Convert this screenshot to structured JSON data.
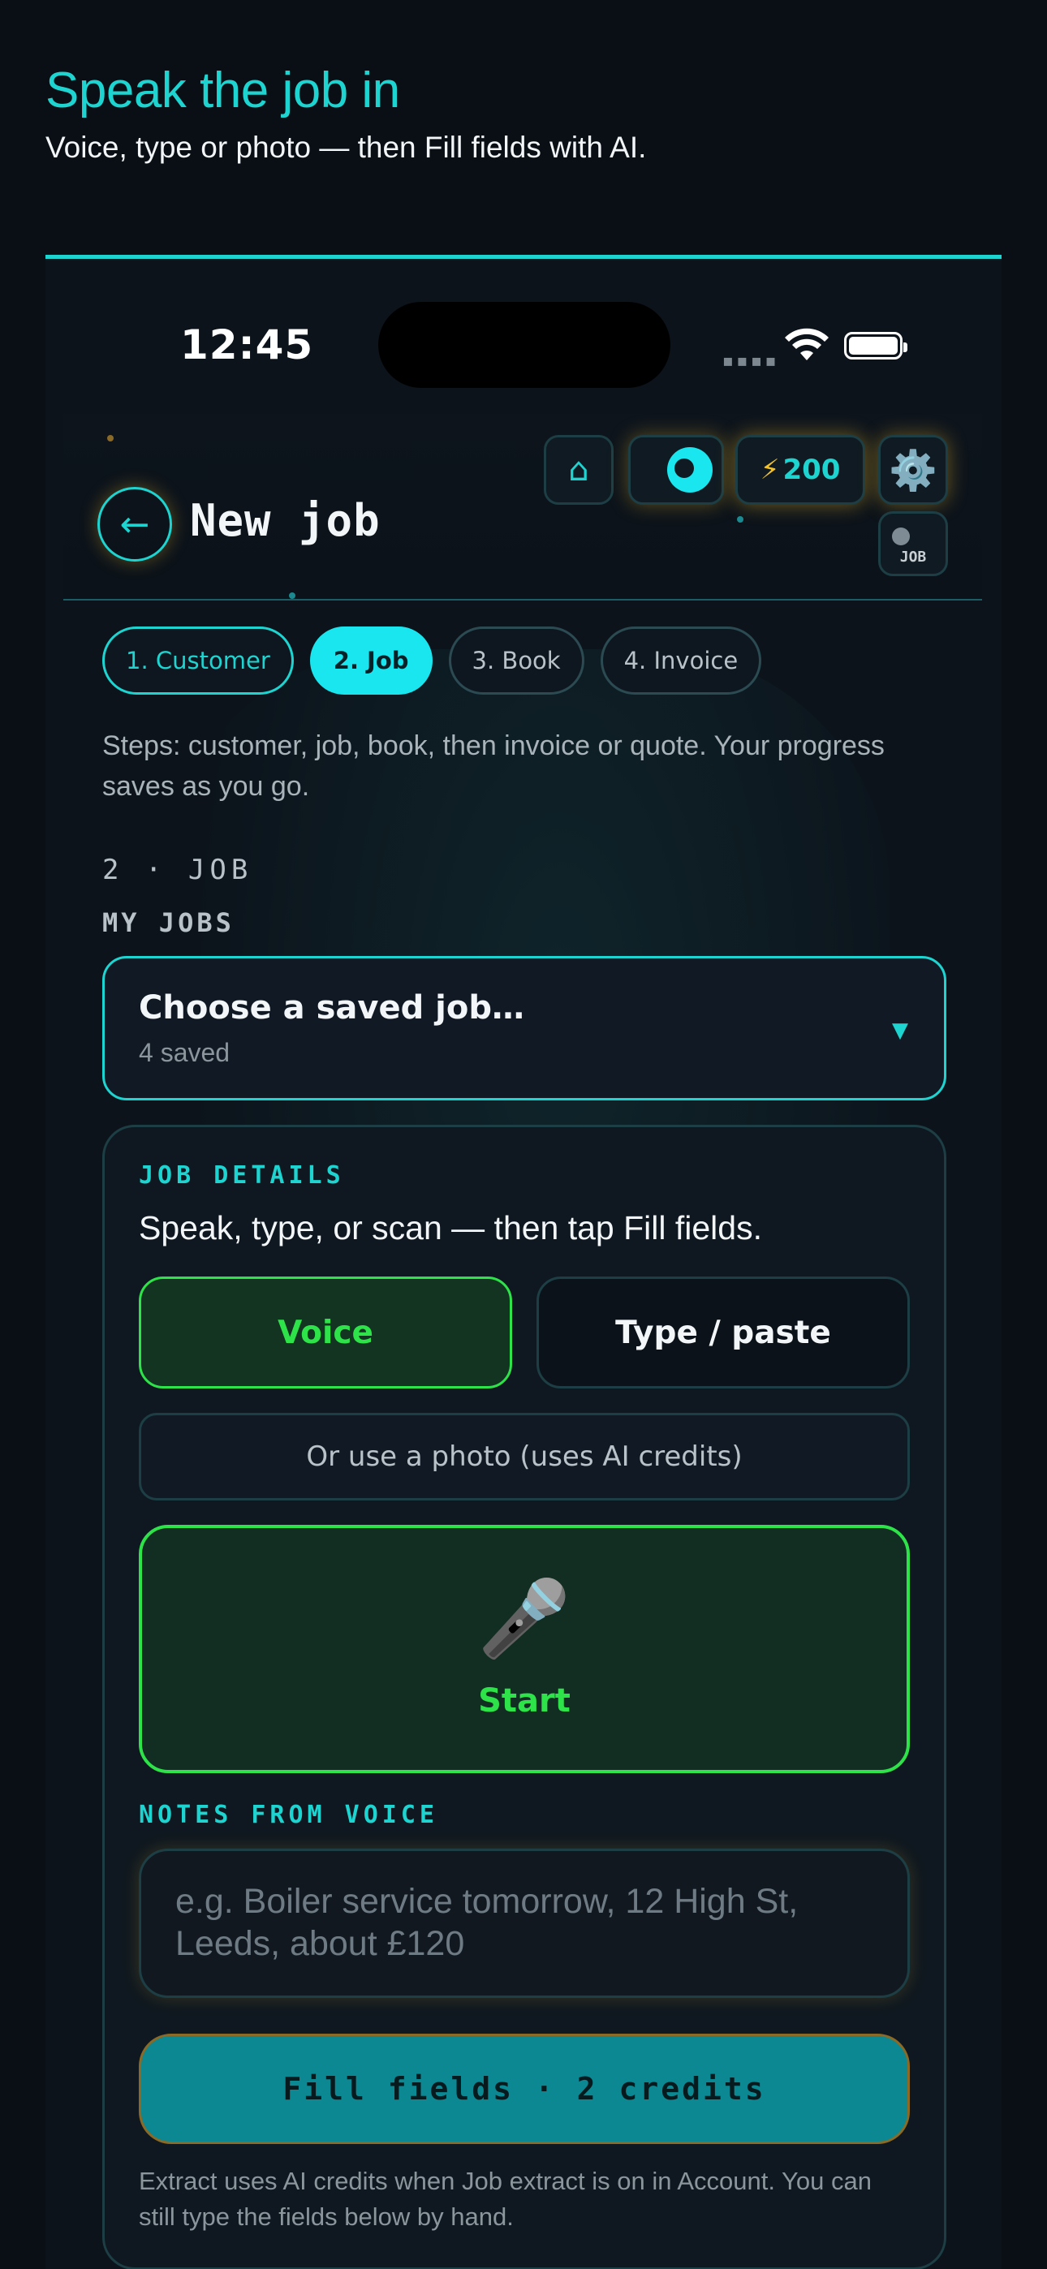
{
  "hero": {
    "title": "Speak the job in",
    "subtitle": "Voice, type or photo — then Fill fields with AI."
  },
  "status": {
    "time": "12:45"
  },
  "header": {
    "title": "New job",
    "home_icon": "⌂",
    "credits": "200",
    "gear_icon": "⚙️",
    "job_toggle_label": "JOB"
  },
  "steps": [
    {
      "label": "1. Customer"
    },
    {
      "label": "2. Job"
    },
    {
      "label": "3. Book"
    },
    {
      "label": "4. Invoice"
    }
  ],
  "steps_text": "Steps: customer, job, book, then invoice or quote. Your progress saves as you go.",
  "section": {
    "eyebrow": "2 · JOB",
    "my_jobs_label": "MY JOBS"
  },
  "saved_jobs": {
    "selected": "Choose a saved job…",
    "count": "4 saved"
  },
  "job_details": {
    "eyebrow": "JOB DETAILS",
    "subtitle": "Speak, type, or scan — then tap Fill fields.",
    "voice_label": "Voice",
    "type_label": "Type / paste",
    "photo_label": "Or use a photo (uses AI credits)",
    "mic_icon": "🎤",
    "start_label": "Start",
    "notes_label": "NOTES FROM VOICE",
    "notes_placeholder": "e.g. Boiler service tomorrow, 12 High St, Leeds, about £120",
    "fill_label": "Fill fields · 2 credits",
    "footnote": "Extract uses AI credits when Job extract is on in Account. You can still type the fields below by hand."
  },
  "colors": {
    "accent_cyan": "#1ed4d0",
    "voice_green": "#2ee34a",
    "glow_amber": "#f0b928",
    "fill_teal": "#0b8892"
  }
}
